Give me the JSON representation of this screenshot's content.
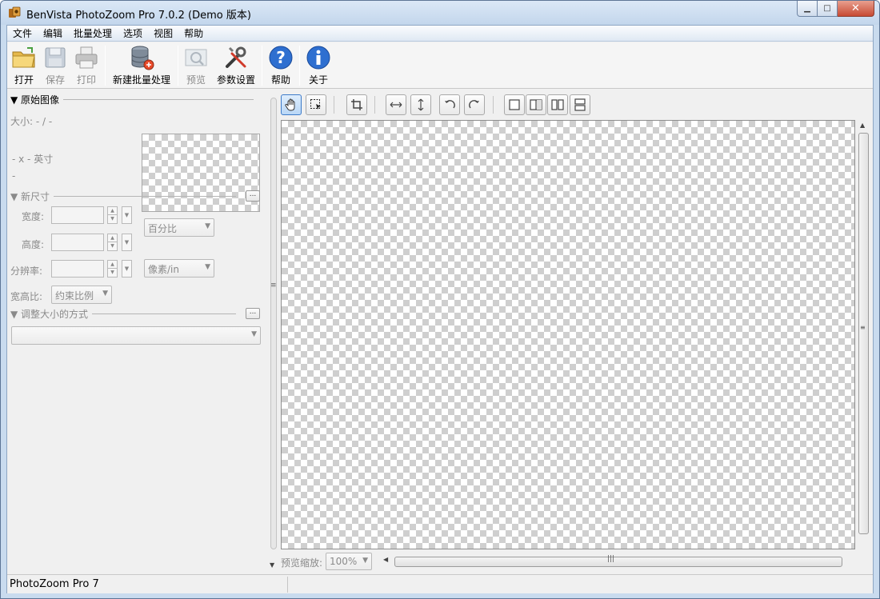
{
  "window": {
    "title": "BenVista PhotoZoom Pro 7.0.2 (Demo 版本)",
    "controls": {
      "minimize": "▁",
      "maximize": "□",
      "close": "✕"
    }
  },
  "menubar": {
    "items": [
      "文件",
      "编辑",
      "批量处理",
      "选项",
      "视图",
      "帮助"
    ]
  },
  "toolbar": {
    "open": "打开",
    "save": "保存",
    "print": "打印",
    "new_batch": "新建批量处理",
    "preview": "预览",
    "settings": "参数设置",
    "help": "帮助",
    "about": "关于"
  },
  "left_panel": {
    "original": {
      "header": "▼ 原始图像",
      "size": "大小: - / -",
      "dimensions": "- x - 英寸",
      "dash": "-"
    },
    "new_size": {
      "header": "▼ 新尺寸",
      "more": "...",
      "width_label": "宽度:",
      "height_label": "高度:",
      "resolution_label": "分辨率:",
      "aspect_label": "宽高比:",
      "unit_select": "百分比",
      "resolution_unit_select": "像素/in",
      "aspect_select": "约束比例"
    },
    "resize_method": {
      "header": "▼ 调整大小的方式",
      "more": "...",
      "select": ""
    }
  },
  "zoom": {
    "label": "预览缩放:",
    "value": "100%"
  },
  "statusbar": {
    "text": "PhotoZoom Pro 7"
  }
}
